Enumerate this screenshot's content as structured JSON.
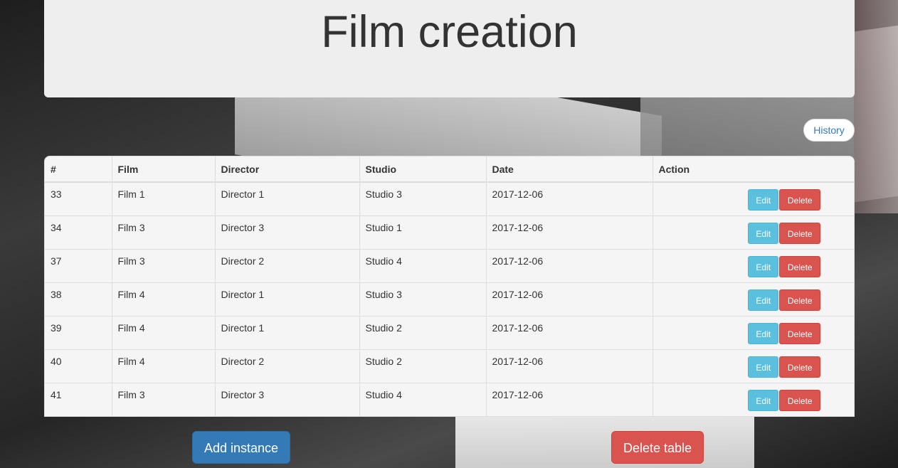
{
  "header": {
    "title": "Film creation"
  },
  "history_label": "History",
  "table": {
    "columns": [
      "#",
      "Film",
      "Director",
      "Studio",
      "Date",
      "Action"
    ],
    "rows": [
      {
        "id": "33",
        "film": "Film 1",
        "director": "Director 1",
        "studio": "Studio 3",
        "date": "2017-12-06"
      },
      {
        "id": "34",
        "film": "Film 3",
        "director": "Director 3",
        "studio": "Studio 1",
        "date": "2017-12-06"
      },
      {
        "id": "37",
        "film": "Film 3",
        "director": "Director 2",
        "studio": "Studio 4",
        "date": "2017-12-06"
      },
      {
        "id": "38",
        "film": "Film 4",
        "director": "Director 1",
        "studio": "Studio 3",
        "date": "2017-12-06"
      },
      {
        "id": "39",
        "film": "Film 4",
        "director": "Director 1",
        "studio": "Studio 2",
        "date": "2017-12-06"
      },
      {
        "id": "40",
        "film": "Film 4",
        "director": "Director 2",
        "studio": "Studio 2",
        "date": "2017-12-06"
      },
      {
        "id": "41",
        "film": "Film 3",
        "director": "Director 3",
        "studio": "Studio 4",
        "date": "2017-12-06"
      }
    ],
    "edit_label": "Edit",
    "delete_label": "Delete"
  },
  "footer": {
    "add_label": "Add instance",
    "delete_table_label": "Delete table"
  },
  "colors": {
    "primary": "#337ab7",
    "info": "#5bc0de",
    "danger": "#d9534f",
    "panel": "#eeeeee"
  }
}
